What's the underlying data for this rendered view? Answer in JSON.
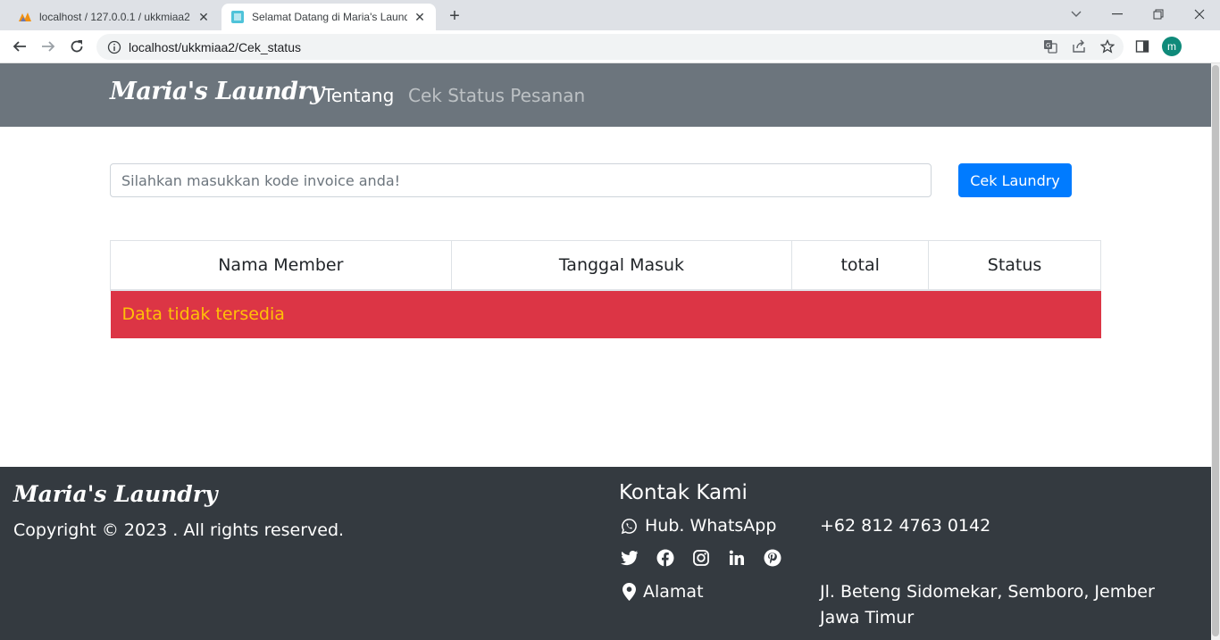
{
  "browser": {
    "tabs": [
      {
        "title": "localhost / 127.0.0.1 / ukkmiaa2 /",
        "icon": "phpmyadmin-icon"
      },
      {
        "title": "Selamat Datang di Maria's Laundry",
        "icon": "site-favicon-icon"
      }
    ],
    "url": "localhost/ukkmiaa2/Cek_status",
    "profile_initial": "m"
  },
  "navbar": {
    "brand": "Maria's Laundry",
    "links": [
      "Tentang",
      "Cek Status Pesanan"
    ]
  },
  "search": {
    "placeholder": "Silahkan masukkan kode invoice anda!",
    "button": "Cek Laundry"
  },
  "table": {
    "headers": [
      "Nama Member",
      "Tanggal Masuk",
      "total",
      "Status"
    ],
    "empty_message": "Data tidak tersedia"
  },
  "footer": {
    "brand": "Maria's Laundry",
    "copyright": "Copyright © 2023 . All rights reserved.",
    "contact_title": "Kontak Kami",
    "whatsapp_label": "Hub. WhatsApp",
    "whatsapp_number": "+62 812 4763 0142",
    "address_label": "Alamat",
    "address_line1": "Jl. Beteng Sidomekar, Semboro, Jember",
    "address_line2": "Jawa Timur",
    "socials": [
      "twitter-icon",
      "facebook-icon",
      "instagram-icon",
      "linkedin-icon",
      "pinterest-icon"
    ]
  },
  "colors": {
    "navbar": "#6c757d",
    "primary": "#007bff",
    "danger": "#dc3545",
    "warning_text": "#ffc107",
    "footer": "#343a40"
  }
}
